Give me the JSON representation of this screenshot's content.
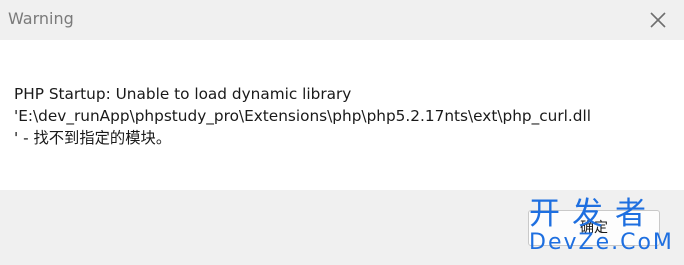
{
  "window": {
    "title": "Warning",
    "close_icon": "close-icon"
  },
  "message": {
    "line1": "PHP Startup: Unable to load dynamic library",
    "line2": "'E:\\dev_runApp\\phpstudy_pro\\Extensions\\php\\php5.2.17nts\\ext\\php_curl.dll",
    "line3": "' - 找不到指定的模块。"
  },
  "footer": {
    "ok_label": "确定"
  },
  "watermark": {
    "top": "开发者",
    "bottom": "DevZe.CoM"
  },
  "colors": {
    "titlebar_bg": "#f0f0f0",
    "footer_bg": "#f0f0f0",
    "watermark": "#1e6fe0"
  }
}
